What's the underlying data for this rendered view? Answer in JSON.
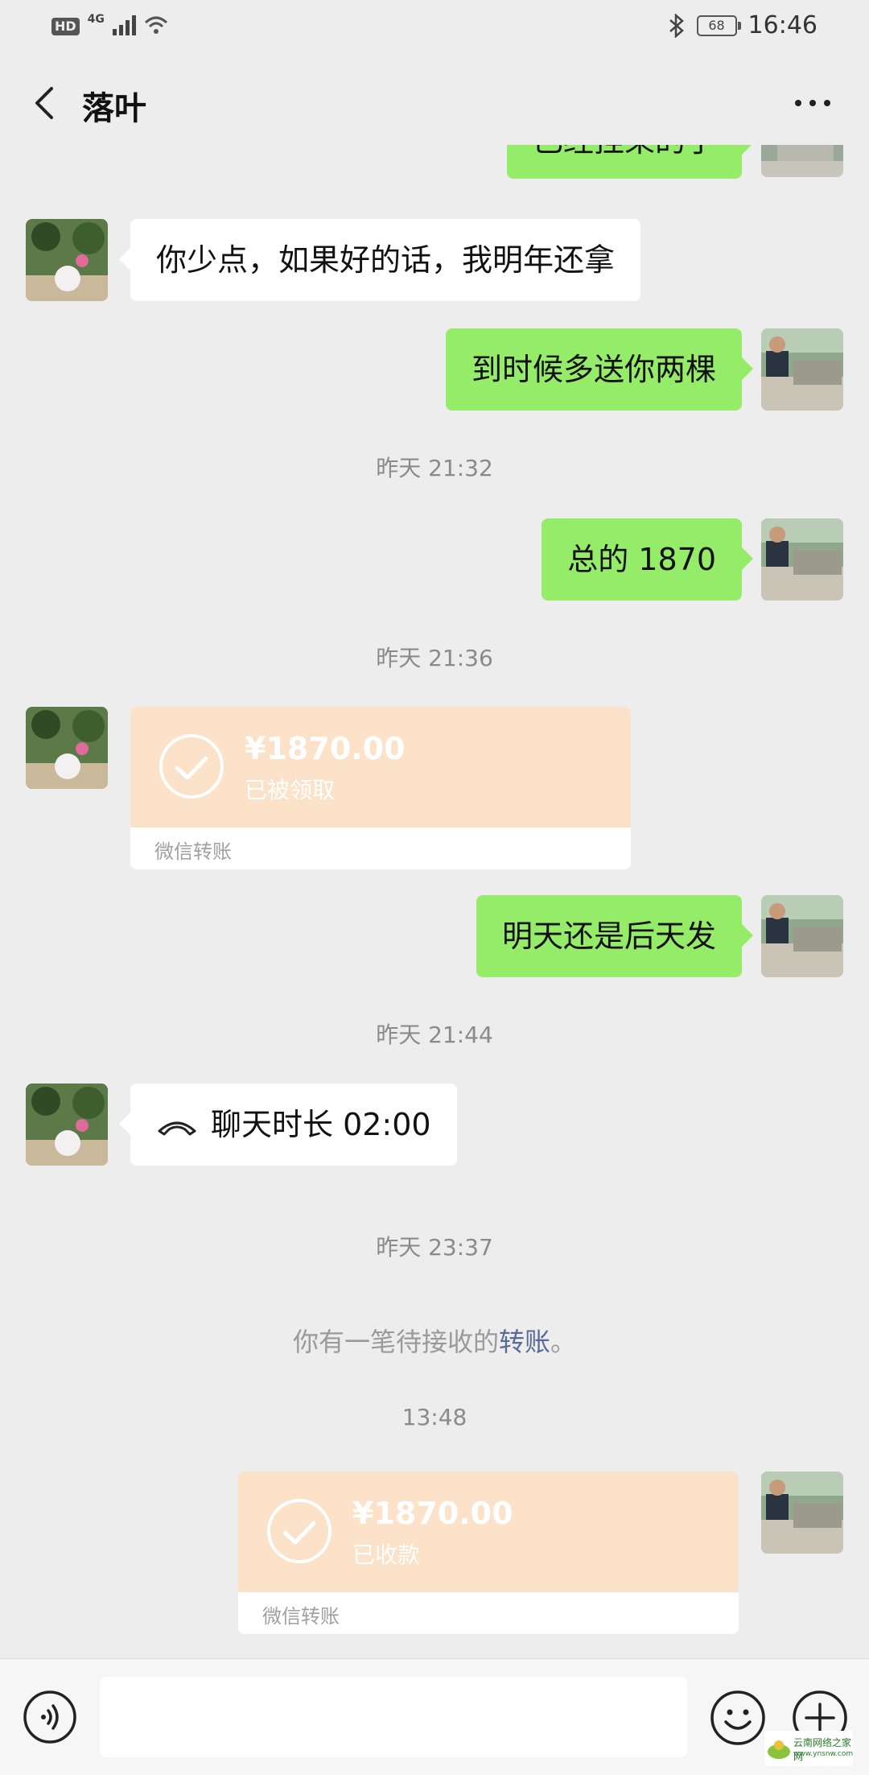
{
  "status_bar": {
    "hd": "HD",
    "network": "4G",
    "battery": "68",
    "time": "16:46"
  },
  "header": {
    "title": "落叶"
  },
  "messages": {
    "cut_top": "已经挂果的了",
    "m1": "你少点，如果好的话，我明年还拿",
    "m2": "到时候多送你两棵",
    "t1": "昨天 21:32",
    "m3": "总的 1870",
    "t2": "昨天 21:36",
    "transfer1": {
      "amount": "¥1870.00",
      "status": "已被领取",
      "label": "微信转账"
    },
    "m4": "明天还是后天发",
    "t3": "昨天 21:44",
    "call": "聊天时长 02:00",
    "t4": "昨天 23:37",
    "sys_text": "你有一笔待接收的",
    "sys_link": "转账",
    "sys_end": "。",
    "t5": "13:48",
    "transfer2": {
      "amount": "¥1870.00",
      "status": "已收款",
      "label": "微信转账"
    }
  },
  "watermark": {
    "text": "云南网络之家网",
    "url": "www.ynsnw.com"
  },
  "colors": {
    "background": "#ededed",
    "outgoing_bubble": "#95ec69",
    "incoming_bubble": "#ffffff",
    "transfer_bg": "#fbe2c8",
    "link": "#576b95"
  }
}
